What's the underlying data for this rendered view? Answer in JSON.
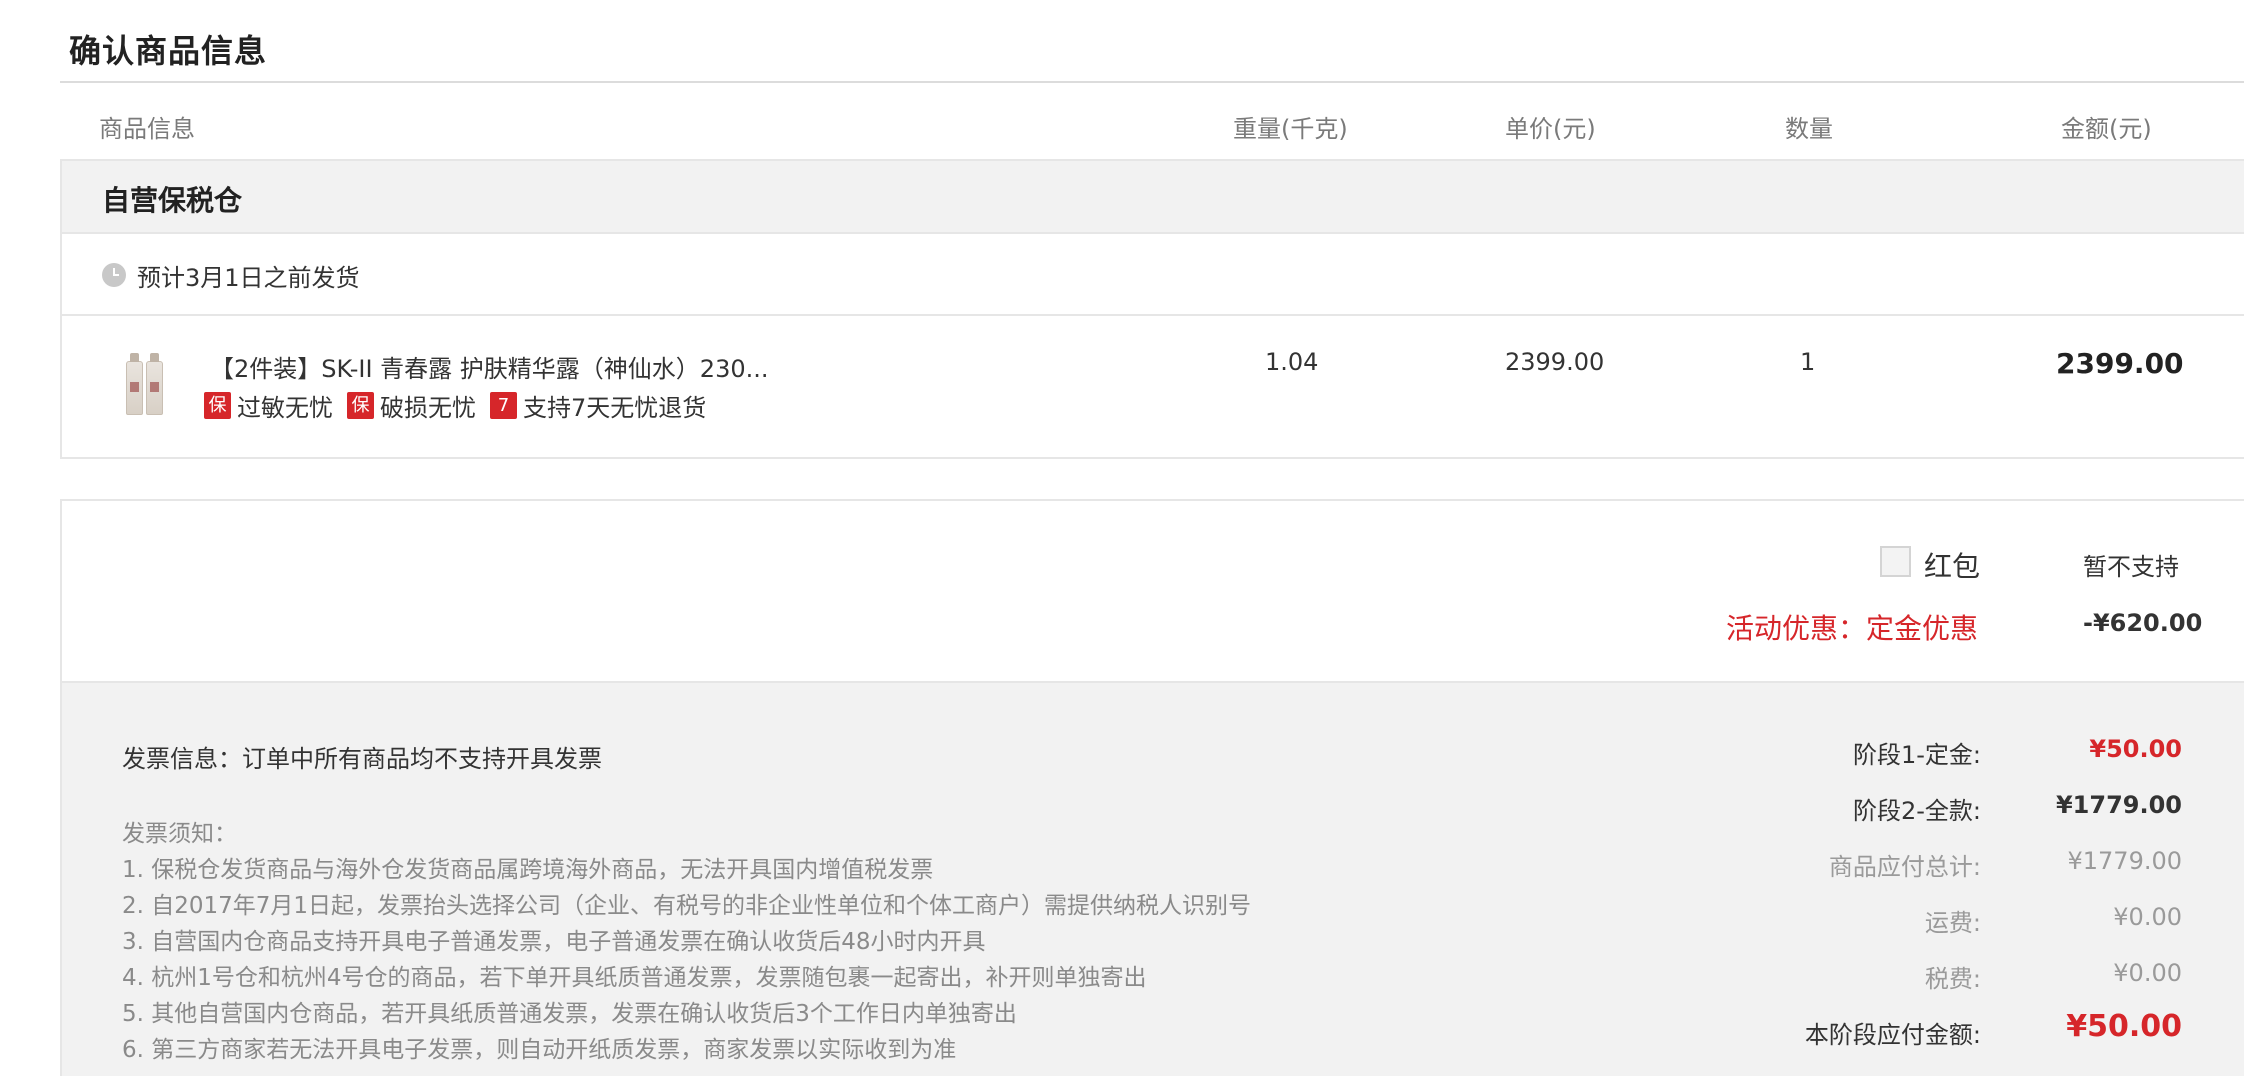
{
  "page": {
    "title": "确认商品信息"
  },
  "table": {
    "headers": {
      "product": "商品信息",
      "weight": "重量(千克)",
      "unit_price": "单价(元)",
      "quantity": "数量",
      "amount": "金额(元)"
    }
  },
  "order": {
    "warehouse": "自营保税仓",
    "ship_notice": "预计3月1日之前发货",
    "item": {
      "name": "【2件装】SK-II 青春露 护肤精华露（神仙水）230...",
      "weight": "1.04",
      "unit_price": "2399.00",
      "quantity": "1",
      "amount": "2399.00",
      "tags": [
        {
          "badge": "保",
          "text": "过敏无忧"
        },
        {
          "badge": "保",
          "text": "破损无忧"
        },
        {
          "badge": "7",
          "text": "支持7天无忧退货"
        }
      ]
    }
  },
  "discount": {
    "hongbao_label": "红包",
    "hongbao_value": "暂不支持",
    "promo_label": "活动优惠：定金优惠",
    "promo_value": "-¥620.00"
  },
  "invoice": {
    "info": "发票信息：订单中所有商品均不支持开具发票",
    "notes_title": "发票须知：",
    "notes": [
      "1. 保税仓发货商品与海外仓发货商品属跨境海外商品，无法开具国内增值税发票",
      "2. 自2017年7月1日起，发票抬头选择公司（企业、有税号的非企业性单位和个体工商户）需提供纳税人识别号",
      "3. 自营国内仓商品支持开具电子普通发票，电子普通发票在确认收货后48小时内开具",
      "4. 杭州1号仓和杭州4号仓的商品，若下单开具纸质普通发票，发票随包裹一起寄出，补开则单独寄出",
      "5. 其他自营国内仓商品，若开具纸质普通发票，发票在确认收货后3个工作日内单独寄出",
      "6. 第三方商家若无法开具电子发票，则自动开纸质发票，商家发票以实际收到为准"
    ]
  },
  "summary": {
    "stage1_label": "阶段1-定金:",
    "stage1_value": "¥50.00",
    "stage2_label": "阶段2-全款:",
    "stage2_value": "¥1779.00",
    "subtotal_label": "商品应付总计:",
    "subtotal_value": "¥1779.00",
    "shipping_label": "运费:",
    "shipping_value": "¥0.00",
    "tax_label": "税费:",
    "tax_value": "¥0.00",
    "due_label": "本阶段应付金额:",
    "due_value": "¥50.00"
  },
  "colors": {
    "accent_red": "#d6262a",
    "panel_grey": "#f2f2f2",
    "border": "#e6e6e6"
  }
}
